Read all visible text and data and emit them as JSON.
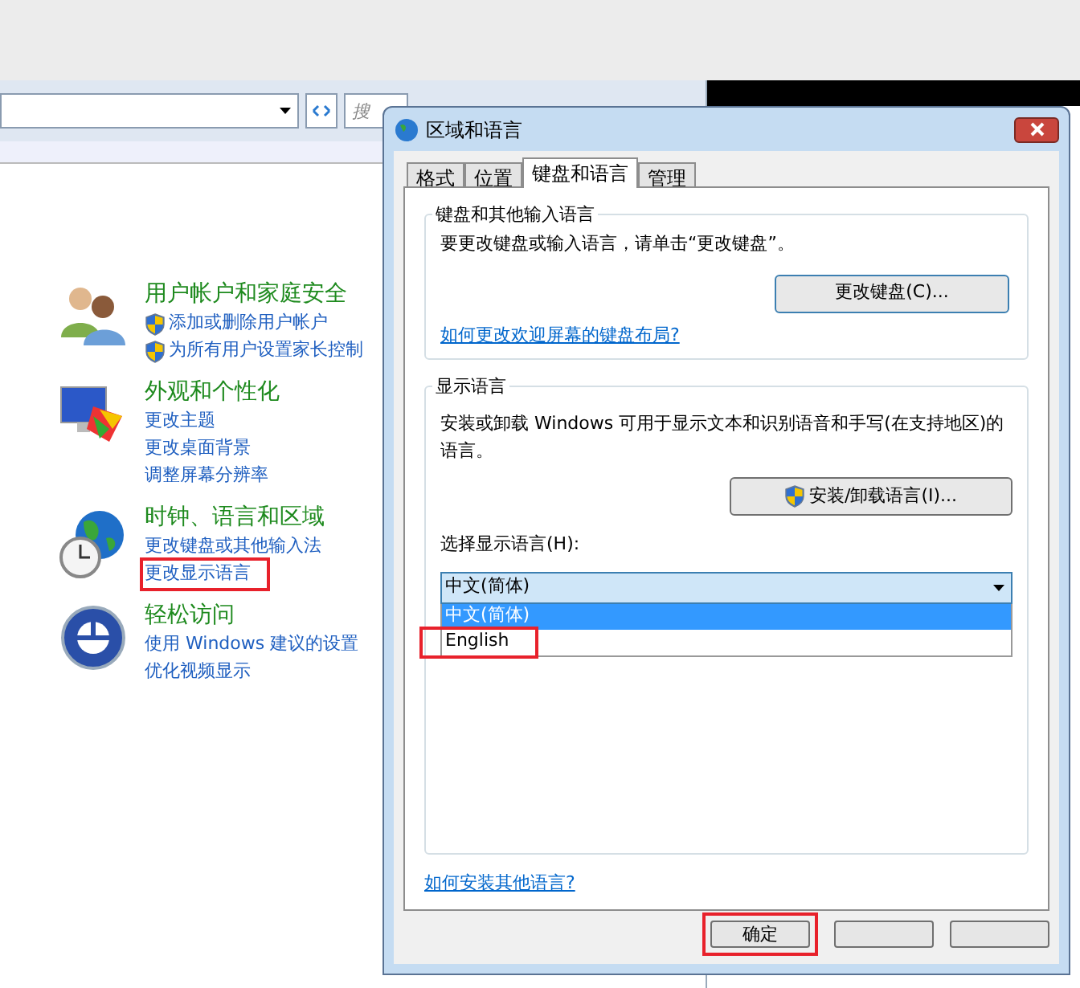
{
  "explorer": {
    "search": {
      "placeholder": "搜"
    },
    "categories": [
      {
        "kind": "users",
        "title": "用户帐户和家庭安全",
        "links": [
          {
            "text": "添加或删除用户帐户",
            "shield": true,
            "highlighted": false
          },
          {
            "text": "为所有用户设置家长控制",
            "shield": true,
            "highlighted": false
          }
        ]
      },
      {
        "kind": "appearance",
        "title": "外观和个性化",
        "links": [
          {
            "text": "更改主题",
            "shield": false,
            "highlighted": false
          },
          {
            "text": "更改桌面背景",
            "shield": false,
            "highlighted": false
          },
          {
            "text": "调整屏幕分辨率",
            "shield": false,
            "highlighted": false
          }
        ]
      },
      {
        "kind": "clock",
        "title": "时钟、语言和区域",
        "links": [
          {
            "text": "更改键盘或其他输入法",
            "shield": false,
            "highlighted": false
          },
          {
            "text": "更改显示语言",
            "shield": false,
            "highlighted": true
          }
        ]
      },
      {
        "kind": "access",
        "title": "轻松访问",
        "links": [
          {
            "text": "使用 Windows 建议的设置",
            "shield": false,
            "highlighted": false
          },
          {
            "text": "优化视频显示",
            "shield": false,
            "highlighted": false
          }
        ]
      }
    ]
  },
  "dialog": {
    "title": "区域和语言",
    "tabs": [
      {
        "label": "格式",
        "selected": false
      },
      {
        "label": "位置",
        "selected": false
      },
      {
        "label": "键盘和语言",
        "selected": true
      },
      {
        "label": "管理",
        "selected": false
      }
    ],
    "keyboard_group": {
      "title": "键盘和其他输入语言",
      "text": "要更改键盘或输入语言，请单击“更改键盘”。",
      "button": "更改键盘(C)...",
      "link": "如何更改欢迎屏幕的键盘布局?"
    },
    "display_group": {
      "title": "显示语言",
      "text": "安装或卸载 Windows 可用于显示文本和识别语音和手写(在支持地区)的语言。",
      "button": "安装/卸载语言(I)...",
      "select_label": "选择显示语言(H):",
      "select_value": "中文(简体)",
      "options": [
        {
          "label": "中文(简体)",
          "selected": true,
          "highlighted": false
        },
        {
          "label": "English",
          "selected": false,
          "highlighted": true
        }
      ]
    },
    "bottom_link": "如何安装其他语言?",
    "ok_button": {
      "label": "确定",
      "highlighted": true
    }
  }
}
